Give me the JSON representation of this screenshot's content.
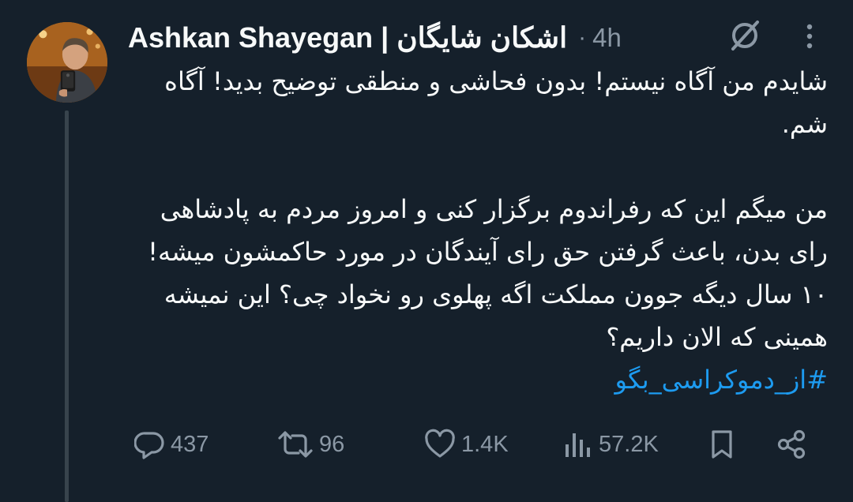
{
  "tweet": {
    "author": {
      "display_name": "Ashkan Shayegan | اشکان شایگان",
      "avatar_icon": "user-photo"
    },
    "separator": "·",
    "time": "4h",
    "paragraphs": [
      "شایدم من آگاه نیستم! بدون فحاشی و منطقی توضیح بدید! آگاه شم.",
      "من میگم این که رفراندوم برگزار کنی و امروز مردم به پادشاهی رای بدن، باعث گرفتن حق رای آیندگان در مورد حاکمشون میشه! ۱۰ سال دیگه جوون مملکت اگه پهلوی رو نخواد چی؟ این نمیشه همینی که الان داریم؟"
    ],
    "hashtag": "#از_دموکراسی_بگو",
    "stats": {
      "replies": "437",
      "retweets": "96",
      "likes": "1.4K",
      "views": "57.2K"
    }
  },
  "colors": {
    "background": "#15202b",
    "text": "#f7f9f9",
    "muted": "#8b98a5",
    "link": "#1d9bf0",
    "thread_line": "#38444d"
  },
  "icons": {
    "grok": "grok-icon",
    "more": "more-dots-icon",
    "reply": "reply-icon",
    "retweet": "retweet-icon",
    "like": "heart-icon",
    "views": "views-chart-icon",
    "bookmark": "bookmark-icon",
    "share": "share-icon"
  }
}
